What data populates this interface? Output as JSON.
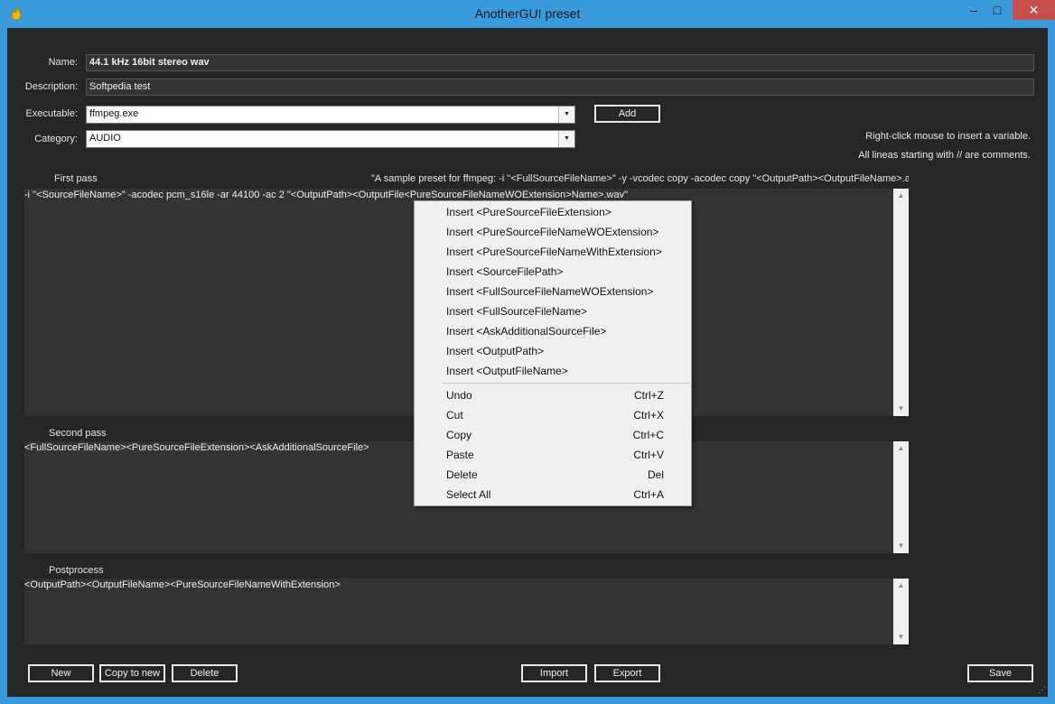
{
  "window": {
    "title": "AnotherGUI preset",
    "minimize_glyph": "–",
    "maximize_glyph": "□",
    "close_glyph": "✕",
    "icon": "flame-icon"
  },
  "form": {
    "name_label": "Name:",
    "name_value": "44.1 kHz 16bit stereo wav",
    "description_label": "Description:",
    "description_value": "Softpedia test",
    "executable_label": "Executable:",
    "executable_value": "ffmpeg.exe",
    "add_label": "Add",
    "category_label": "Category:",
    "category_value": "AUDIO",
    "hint1": "Right-click mouse to insert a variable.",
    "hint2": "All lineas starting with // are comments."
  },
  "first_pass": {
    "label": "First pass",
    "sample": "\"A sample preset for ffmpeg:  -i \"<FullSourceFileName>\" -y  -vcodec copy  -acodec copy \"<OutputPath><OutputFileName>.avi",
    "text": "-i \"<SourceFileName>\" -acodec pcm_s16le -ar 44100 -ac 2 \"<OutputPath><OutputFile<PureSourceFileNameWOExtension>Name>.wav\""
  },
  "second_pass": {
    "label": "Second pass",
    "text": "<FullSourceFileName><PureSourceFileExtension><AskAdditionalSourceFile>"
  },
  "postprocess": {
    "label": "Postprocess",
    "text": "<OutputPath><OutputFileName><PureSourceFileNameWithExtension>"
  },
  "context_menu": {
    "inserts": [
      "Insert <PureSourceFileExtension>",
      "Insert <PureSourceFileNameWOExtension>",
      "Insert <PureSourceFileNameWithExtension>",
      "Insert <SourceFilePath>",
      "Insert <FullSourceFileNameWOExtension>",
      "Insert <FullSourceFileName>",
      "Insert <AskAdditionalSourceFile>",
      "Insert <OutputPath>",
      "Insert <OutputFileName>"
    ],
    "edit": [
      {
        "label": "Undo",
        "shortcut": "Ctrl+Z"
      },
      {
        "label": "Cut",
        "shortcut": "Ctrl+X"
      },
      {
        "label": "Copy",
        "shortcut": "Ctrl+C"
      },
      {
        "label": "Paste",
        "shortcut": "Ctrl+V"
      },
      {
        "label": "Delete",
        "shortcut": "Del"
      },
      {
        "label": "Select All",
        "shortcut": "Ctrl+A"
      }
    ]
  },
  "buttons": {
    "new": "New",
    "copy_to_new": "Copy to new",
    "delete": "Delete",
    "import": "Import",
    "export": "Export",
    "save": "Save"
  },
  "scroll_glyphs": {
    "up": "▲",
    "down": "▼"
  },
  "combo_glyph": "▼"
}
